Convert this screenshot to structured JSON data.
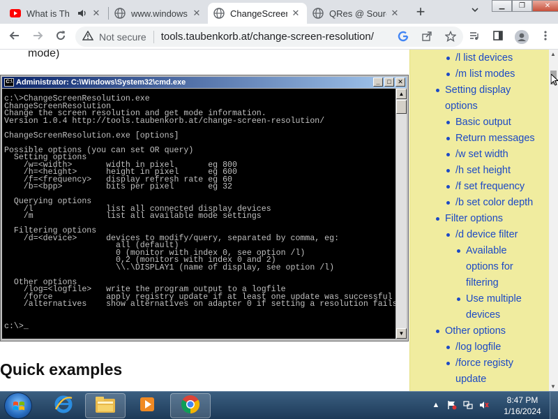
{
  "browser": {
    "tabs": [
      {
        "title": "What is Th",
        "favicon": "youtube-icon",
        "audio": true
      },
      {
        "title": "www.windows",
        "favicon": "globe-icon"
      },
      {
        "title": "ChangeScreen",
        "favicon": "globe-icon",
        "active": true
      },
      {
        "title": "QRes @ Source",
        "favicon": "globe-icon"
      }
    ],
    "new_tab_label": "+",
    "address": {
      "security_label": "Not secure",
      "url": "tools.taubenkorb.at/change-screen-resolution/"
    }
  },
  "page": {
    "partial_text": "mode)",
    "section_heading": "Quick examples"
  },
  "console": {
    "title": "Administrator: C:\\Windows\\System32\\cmd.exe",
    "lines": [
      "c:\\>ChangeScreenResolution.exe",
      "ChangeScreenResolution",
      "Change the screen resolution and get mode information.",
      "Version 1.0.4 http://tools.taubenkorb.at/change-screen-resolution/",
      "",
      "ChangeScreenResolution.exe [options]",
      "",
      "Possible options (you can set OR query)",
      "  Setting options",
      "    /w=<width>       width in pixel       eg 800",
      "    /h=<height>      height in pixel      eg 600",
      "    /f=<frequency>   display refresh rate eg 60",
      "    /b=<bpp>         bits per pixel       eg 32",
      "",
      "  Querying options",
      "    /l               list all connected display devices",
      "    /m               list all available mode settings",
      "",
      "  Filtering options",
      "    /d=<device>      devices to modify/query, separated by comma, eg:",
      "                       all (default)",
      "                       0 (monitor with index 0, see option /l)",
      "                       0,2 (monitors with index 0 and 2)",
      "                       \\\\.\\DISPLAY1 (name of display, see option /l)",
      "",
      "  Other options",
      "    /log=<logfile>   write the program output to a logfile",
      "    /force           apply registry update if at least one update was successful",
      "    /alternatives    show alternatives on adapter 0 if setting a resolution fails",
      "",
      "",
      "c:\\>_"
    ]
  },
  "toc": [
    {
      "text": "/l list devices",
      "level": 2
    },
    {
      "text": "/m list modes",
      "level": 2
    },
    {
      "text": "Setting display",
      "level": 1
    },
    {
      "text": "options",
      "level": 1,
      "cont": true
    },
    {
      "text": "Basic output",
      "level": 2
    },
    {
      "text": "Return messages",
      "level": 2
    },
    {
      "text": "/w set width",
      "level": 2
    },
    {
      "text": "/h set height",
      "level": 2
    },
    {
      "text": "/f set frequency",
      "level": 2
    },
    {
      "text": "/b set color depth",
      "level": 2
    },
    {
      "text": "Filter options",
      "level": 1
    },
    {
      "text": "/d device filter",
      "level": 2
    },
    {
      "text": "Available",
      "level": 3
    },
    {
      "text": "options for",
      "level": 3,
      "cont": true
    },
    {
      "text": "filtering",
      "level": 3,
      "cont": true
    },
    {
      "text": "Use multiple",
      "level": 3
    },
    {
      "text": "devices",
      "level": 3,
      "cont": true
    },
    {
      "text": "Other options",
      "level": 1
    },
    {
      "text": "/log logfile",
      "level": 2
    },
    {
      "text": "/force registy",
      "level": 2
    },
    {
      "text": "update",
      "level": 2,
      "cont": true
    }
  ],
  "taskbar": {
    "apps": [
      {
        "name": "internet-explorer-icon"
      },
      {
        "name": "file-explorer-icon",
        "running": true
      },
      {
        "name": "media-player-icon"
      },
      {
        "name": "chrome-icon",
        "running": true
      }
    ],
    "time": "8:47 PM",
    "date": "1/16/2024"
  },
  "colors": {
    "toc_background": "#f0ec9f",
    "link": "#1c49c5",
    "console_bg": "#000000",
    "console_text": "#c0c0c0"
  }
}
